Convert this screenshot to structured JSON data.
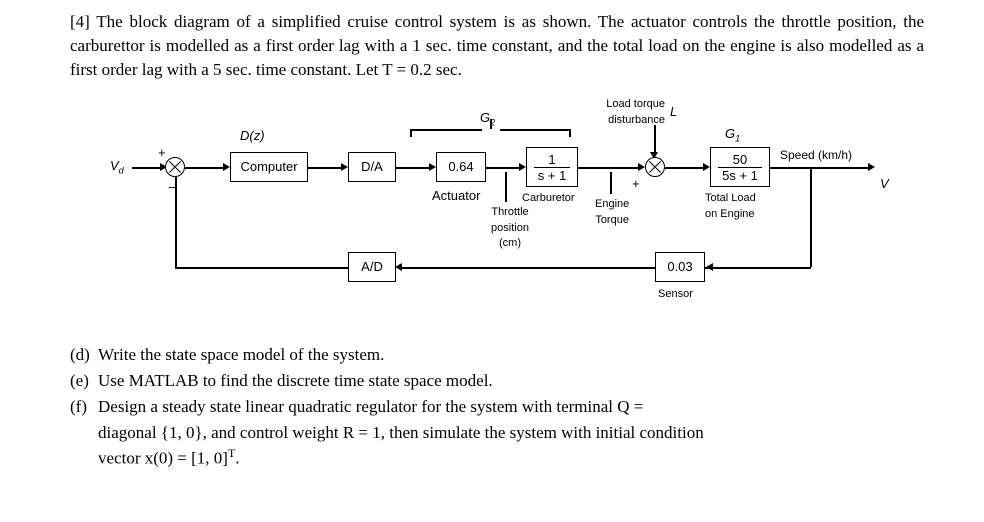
{
  "problem_number": "[4]",
  "intro": "The block diagram of a simplified cruise control system is as shown. The actuator controls the throttle position, the carburettor is modelled as a first order lag with a 1 sec. time constant, and the total load on the engine is also modelled as a first order lag with a 5 sec. time constant. Let T = 0.2 sec.",
  "diagram": {
    "input_label": "V",
    "input_sub": "d",
    "sj1_plus": "+",
    "sj1_minus": "−",
    "dz_label": "D(z)",
    "computer": "Computer",
    "da": "D/A",
    "g2_label": "G",
    "g2_sub": "2",
    "actuator_gain": "0.64",
    "actuator_label": "Actuator",
    "throttle_label1": "Throttle",
    "throttle_label2": "position",
    "throttle_label3": "(cm)",
    "carb_num": "1",
    "carb_den": "s + 1",
    "carb_label": "Carburetor",
    "engine_label1": "Engine",
    "engine_label2": "Torque",
    "disturb_label1": "Load torque",
    "disturb_label2": "disturbance",
    "disturb_sym": "L",
    "sj2_plus": "+",
    "g1_label": "G",
    "g1_sub": "1",
    "load_num": "50",
    "load_den": "5s + 1",
    "load_label1": "Total Load",
    "load_label2": "on Engine",
    "speed_label": "Speed (km/h)",
    "output_sym": "V",
    "sensor_gain": "0.03",
    "sensor_label": "Sensor",
    "ad": "A/D"
  },
  "q_d_tag": "(d)",
  "q_d": "Write the state space model of the system.",
  "q_e_tag": "(e)",
  "q_e": "Use MATLAB to find the discrete time state space model.",
  "q_f_tag": "(f)",
  "q_f_line1": "Design a steady state linear quadratic regulator for the system with terminal Q =",
  "q_f_line2": "diagonal {1, 0}, and control weight R = 1, then simulate the system with initial condition",
  "q_f_line3a": "vector x(0) = [1, 0]",
  "q_f_line3b": "T",
  "q_f_line3c": "."
}
